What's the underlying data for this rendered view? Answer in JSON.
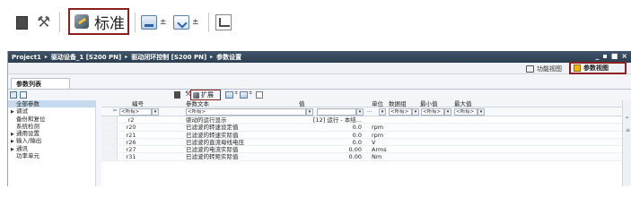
{
  "zoom_toolbar": {
    "standard_label": "标准",
    "dark_icon": "view-dark-icon",
    "wrench_icon": "wrench-icon",
    "upload_icon": "upload-icon",
    "download_icon": "download-icon",
    "monitor_icon": "monitor-icon",
    "arrow_glyph": "±"
  },
  "window": {
    "breadcrumb": [
      "Project1",
      "驱动设备_1 [S200 PN]",
      "驱动闭环控制 [S200 PN]",
      "参数设置"
    ],
    "crumb_sep": "▸",
    "controls": [
      "_",
      "▪",
      "■",
      "×"
    ]
  },
  "viewbar": {
    "function_view": "功能视图",
    "parameter_view": "参数视图"
  },
  "tabs": {
    "param_list": "参数列表"
  },
  "inner_toolbar": {
    "extend_label": "扩展"
  },
  "nav": {
    "items": [
      {
        "label": "全部参数",
        "expandable": false,
        "selected": true
      },
      {
        "label": "调试",
        "expandable": true,
        "selected": false
      },
      {
        "label": "备份和复位",
        "expandable": false,
        "selected": false
      },
      {
        "label": "系统检测",
        "expandable": false,
        "selected": false
      },
      {
        "label": "通用设置",
        "expandable": true,
        "selected": false
      },
      {
        "label": "输入/输出",
        "expandable": true,
        "selected": false
      },
      {
        "label": "通讯",
        "expandable": true,
        "selected": false
      },
      {
        "label": "功率单元",
        "expandable": false,
        "selected": false
      }
    ]
  },
  "grid": {
    "headers": {
      "number": "编号",
      "text": "参数文本",
      "value": "值",
      "unit": "单位",
      "data_group": "数据组",
      "min": "最小值",
      "max": "最大值"
    },
    "filter": {
      "number": "<所有>",
      "text": "<所有>",
      "value": "",
      "unit": "...",
      "unit_dd": "<所有>",
      "data_group": "<所有>",
      "min": "<所有>",
      "max": "<所有>"
    },
    "rows": [
      {
        "number": "r2",
        "text": "驱动的运行显示",
        "value": "[12] 运行 - 本结...",
        "unit": ""
      },
      {
        "number": "r20",
        "text": "已滤波的转速设定值",
        "value": "0.0",
        "unit": "rpm"
      },
      {
        "number": "r21",
        "text": "已滤波的转速实际值",
        "value": "0.0",
        "unit": "rpm"
      },
      {
        "number": "r26",
        "text": "已滤波的直流母线电压",
        "value": "0.0",
        "unit": "V"
      },
      {
        "number": "r27",
        "text": "已滤波的电流实际值",
        "value": "0.00",
        "unit": "Arms"
      },
      {
        "number": "r31",
        "text": "已滤波的转矩实际值",
        "value": "0.00",
        "unit": "Nm"
      }
    ]
  },
  "colors": {
    "highlight_border": "#8b2020",
    "titlebar": "#34485c",
    "selection": "#c7dbf0"
  }
}
